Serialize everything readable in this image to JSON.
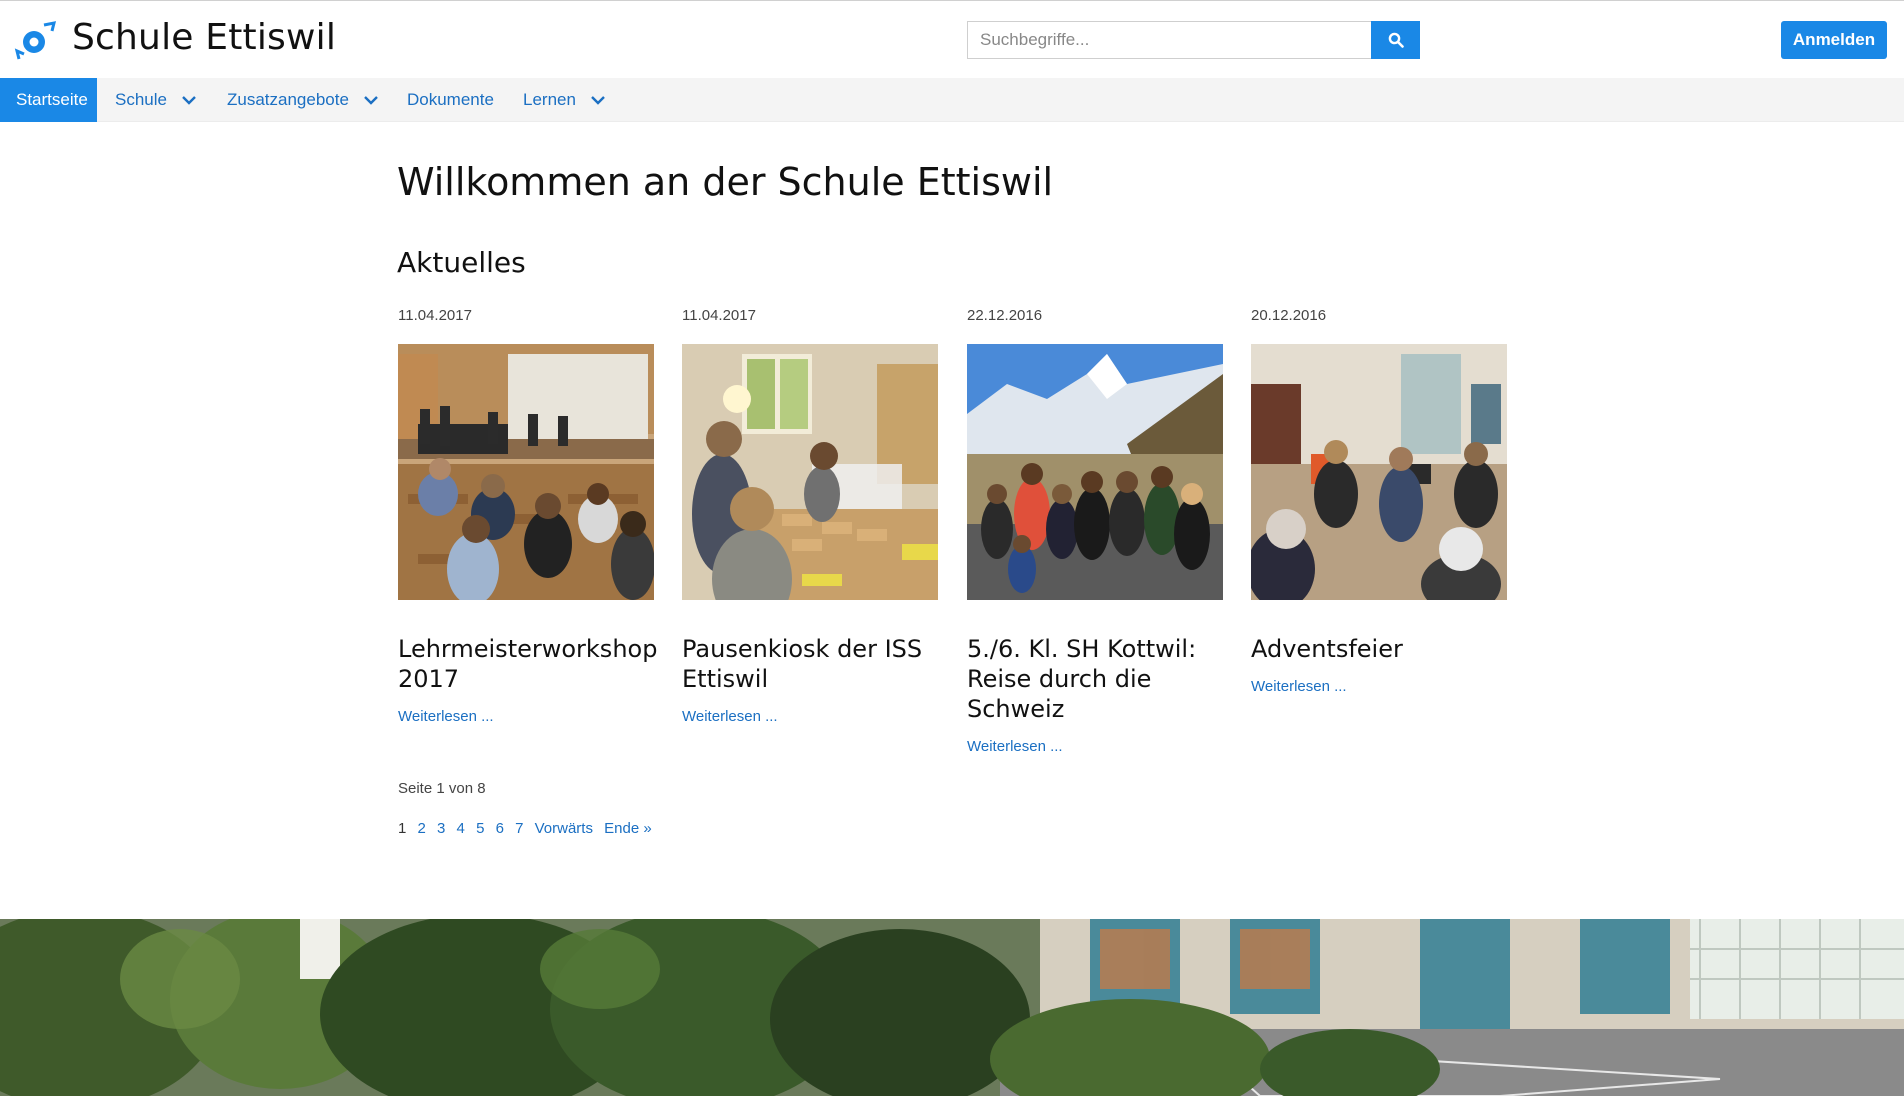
{
  "header": {
    "site_title": "Schule Ettiswil",
    "search_placeholder": "Suchbegriffe...",
    "login_label": "Anmelden"
  },
  "nav": {
    "items": [
      {
        "label": "Startseite",
        "active": true,
        "dropdown": false
      },
      {
        "label": "Schule",
        "active": false,
        "dropdown": true
      },
      {
        "label": "Zusatzangebote",
        "active": false,
        "dropdown": true
      },
      {
        "label": "Dokumente",
        "active": false,
        "dropdown": false
      },
      {
        "label": "Lernen",
        "active": false,
        "dropdown": true
      }
    ]
  },
  "main": {
    "page_title": "Willkommen an der Schule Ettiswil",
    "section_title": "Aktuelles",
    "articles": [
      {
        "date": "11.04.2017",
        "title": "Lehrmeisterworkshop 2017",
        "more": "Weiterlesen ..."
      },
      {
        "date": "11.04.2017",
        "title": "Pausenkiosk der ISS Ettiswil",
        "more": "Weiterlesen ..."
      },
      {
        "date": "22.12.2016",
        "title": "5./6. Kl. SH Kottwil: Reise durch die Schweiz",
        "more": "Weiterlesen ..."
      },
      {
        "date": "20.12.2016",
        "title": "Adventsfeier",
        "more": "Weiterlesen ..."
      }
    ],
    "pager": {
      "info": "Seite 1 von 8",
      "pages": [
        "1",
        "2",
        "3",
        "4",
        "5",
        "6",
        "7"
      ],
      "next": "Vorwärts",
      "end": "Ende »"
    }
  },
  "colors": {
    "accent": "#1a88e6",
    "link": "#1b6fc2",
    "nav_bg": "#f4f4f4"
  }
}
